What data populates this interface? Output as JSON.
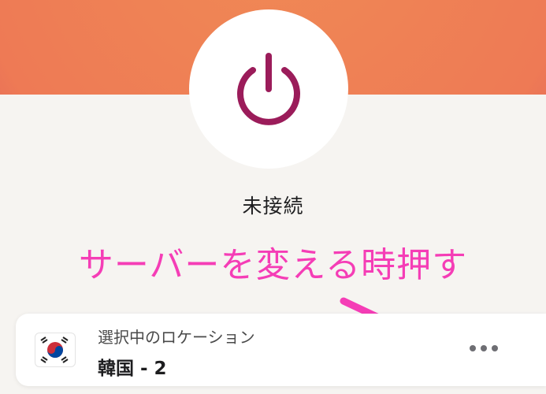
{
  "status": {
    "label": "未接続"
  },
  "annotation": {
    "text": "サーバーを変える時押す",
    "color": "#f53db6"
  },
  "location": {
    "caption": "選択中のロケーション",
    "name": "韓国 - 2",
    "flag": "south-korea-flag"
  },
  "colors": {
    "accent": "#9b1c5a",
    "hero_gradient": [
      "#f29a62",
      "#e05f5e",
      "#c24b72"
    ],
    "background": "#f6f4f1"
  },
  "icons": {
    "power": "power-icon",
    "more": "more-horizontal-icon"
  }
}
